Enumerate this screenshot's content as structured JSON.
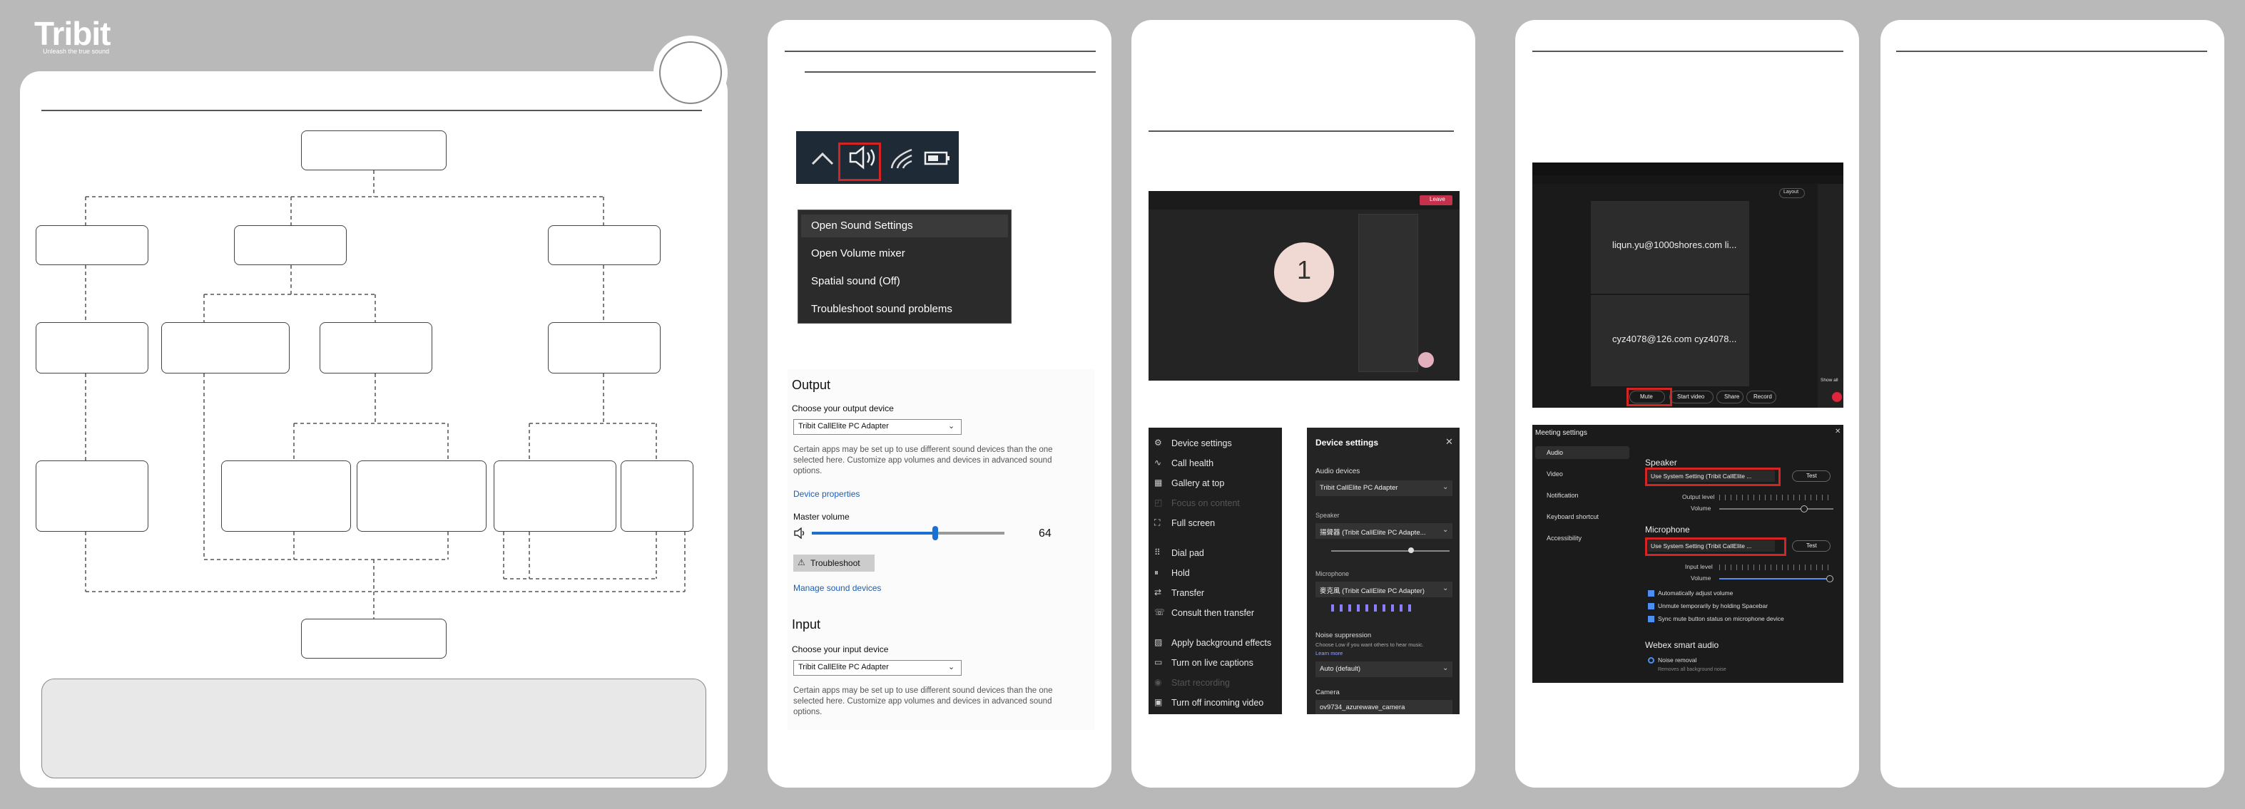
{
  "brand": {
    "logo": "Tribit",
    "tagline": "Unleash the true sound"
  },
  "volume_menu": {
    "items": [
      "Open Sound Settings",
      "Open Volume mixer",
      "Spatial sound (Off)",
      "Troubleshoot sound problems"
    ]
  },
  "sound_settings": {
    "output_heading": "Output",
    "output_device_label": "Choose your output device",
    "output_device": "Tribit CallElite PC Adapter",
    "output_note": "Certain apps may be set up to use different sound devices than the one selected here. Customize app volumes and devices in advanced sound options.",
    "device_properties": "Device properties",
    "master_volume_label": "Master volume",
    "master_volume": 64,
    "troubleshoot": "Troubleshoot",
    "manage_devices": "Manage sound devices",
    "input_heading": "Input",
    "input_device_label": "Choose your input device",
    "input_device": "Tribit CallElite PC Adapter",
    "input_note": "Certain apps may be set up to use different sound devices than the one selected here. Customize app volumes and devices in advanced sound options."
  },
  "teams_call": {
    "participant_count": "1",
    "leave_button": "Leave",
    "menu": [
      {
        "icon": "gear-icon",
        "label": "Device settings",
        "enabled": true
      },
      {
        "icon": "pulse-icon",
        "label": "Call health",
        "enabled": true
      },
      {
        "icon": "grid-icon",
        "label": "Gallery at top",
        "enabled": true
      },
      {
        "icon": "focus-icon",
        "label": "Focus on content",
        "enabled": false
      },
      {
        "icon": "fullscreen-icon",
        "label": "Full screen",
        "enabled": true
      },
      {
        "icon": "dialpad-icon",
        "label": "Dial pad",
        "enabled": true
      },
      {
        "icon": "pause-icon",
        "label": "Hold",
        "enabled": true
      },
      {
        "icon": "transfer-icon",
        "label": "Transfer",
        "enabled": true
      },
      {
        "icon": "consult-icon",
        "label": "Consult then transfer",
        "enabled": true
      },
      {
        "icon": "background-icon",
        "label": "Apply background effects",
        "enabled": true
      },
      {
        "icon": "captions-icon",
        "label": "Turn on live captions",
        "enabled": true
      },
      {
        "icon": "record-icon",
        "label": "Start recording",
        "enabled": false
      },
      {
        "icon": "video-off-icon",
        "label": "Turn off incoming video",
        "enabled": true
      }
    ]
  },
  "teams_device_settings": {
    "title": "Device settings",
    "audio_devices_label": "Audio devices",
    "audio_device": "Tribit CallElite PC Adapter",
    "speaker_label": "Speaker",
    "speaker_device": "揚聲器 (Tribit CallElite PC Adapte...",
    "microphone_label": "Microphone",
    "microphone_device": "麥克風 (Tribit CallElite PC Adapter)",
    "noise_label": "Noise suppression",
    "noise_desc": "Choose Low if you want others to hear music.",
    "learn_more": "Learn more",
    "noise_value": "Auto (default)",
    "camera_label": "Camera",
    "camera_device": "ov9734_azurewave_camera"
  },
  "webex_meeting": {
    "participants": [
      "liqun.yu@1000shores.com li...",
      "cyz4078@126.com cyz4078..."
    ],
    "toolbar": [
      "Mute",
      "Start video",
      "Share",
      "Record"
    ],
    "layout_label": "Layout",
    "show_all": "Show all"
  },
  "webex_settings": {
    "title": "Meeting settings",
    "nav": [
      "Audio",
      "Video",
      "Notification",
      "Keyboard shortcut",
      "Accessibility"
    ],
    "speaker_heading": "Speaker",
    "speaker_device": "Use System Setting (Tribit CallElite ...",
    "test_label": "Test",
    "output_level_label": "Output level",
    "volume_label": "Volume",
    "microphone_heading": "Microphone",
    "microphone_device": "Use System Setting (Tribit CallElite ...",
    "input_level_label": "Input level",
    "checkboxes": [
      "Automatically adjust volume",
      "Unmute temporarily by holding Spacebar",
      "Sync mute button status on microphone device"
    ],
    "smart_audio_heading": "Webex smart audio",
    "noise_removal": "Noise removal",
    "noise_removal_desc": "Removes all background noise"
  }
}
